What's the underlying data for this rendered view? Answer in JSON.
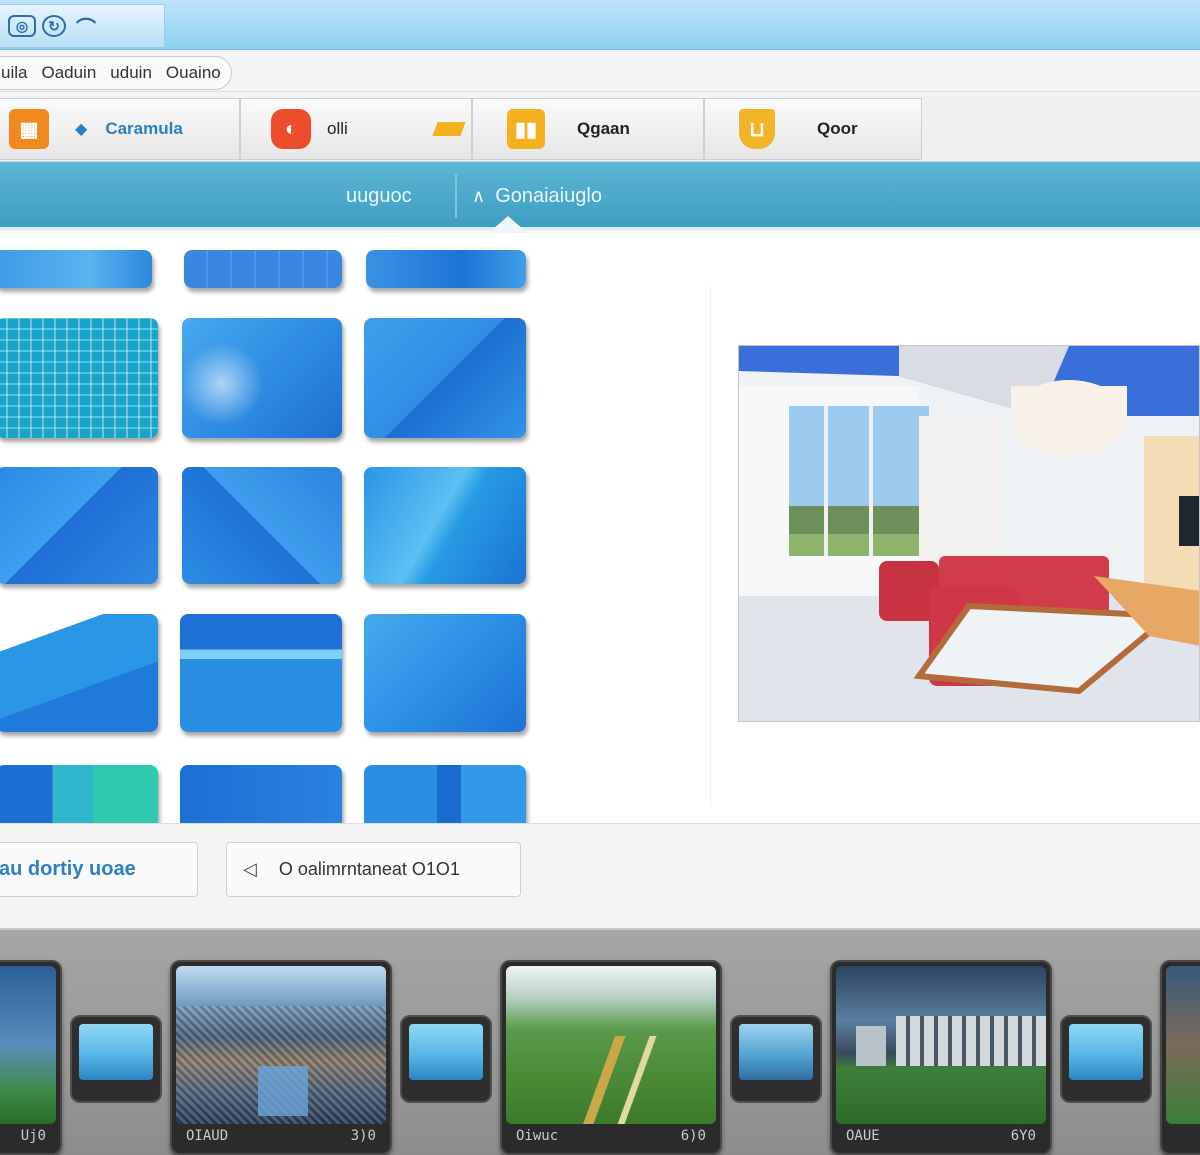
{
  "window": {
    "title_tab_icons": [
      "app-icon",
      "sync-icon",
      "minimize-icon"
    ]
  },
  "menu": {
    "items": [
      "uila",
      "Oaduin",
      "uduin",
      "Ouaino"
    ]
  },
  "toolbar": {
    "buttons": [
      {
        "label": "Caramula",
        "icon": "photo-icon",
        "color": "#f08a1e"
      },
      {
        "label": "olli",
        "icon": "palette-icon",
        "color": "#ee4d2d"
      },
      {
        "label": "Qgaan",
        "icon": "shirt-icon",
        "color": "#f4b01f"
      },
      {
        "label": "Qoor",
        "icon": "lock-icon",
        "color": "#f2b52a"
      }
    ]
  },
  "subbar": {
    "left_label": "uuguoc",
    "right_label": "Gonaiaiuglo"
  },
  "actions": {
    "left_button": "au dortiy uoae",
    "right_button": "O oalimrntaneat O1O1"
  },
  "filmstrip": {
    "items": [
      {
        "left": "",
        "right": "Uj0"
      },
      {
        "left": "OIAUD",
        "right": "3)0"
      },
      {
        "left": "Oiwuc",
        "right": "6)0"
      },
      {
        "left": "OAUE",
        "right": "6Y0"
      }
    ]
  }
}
